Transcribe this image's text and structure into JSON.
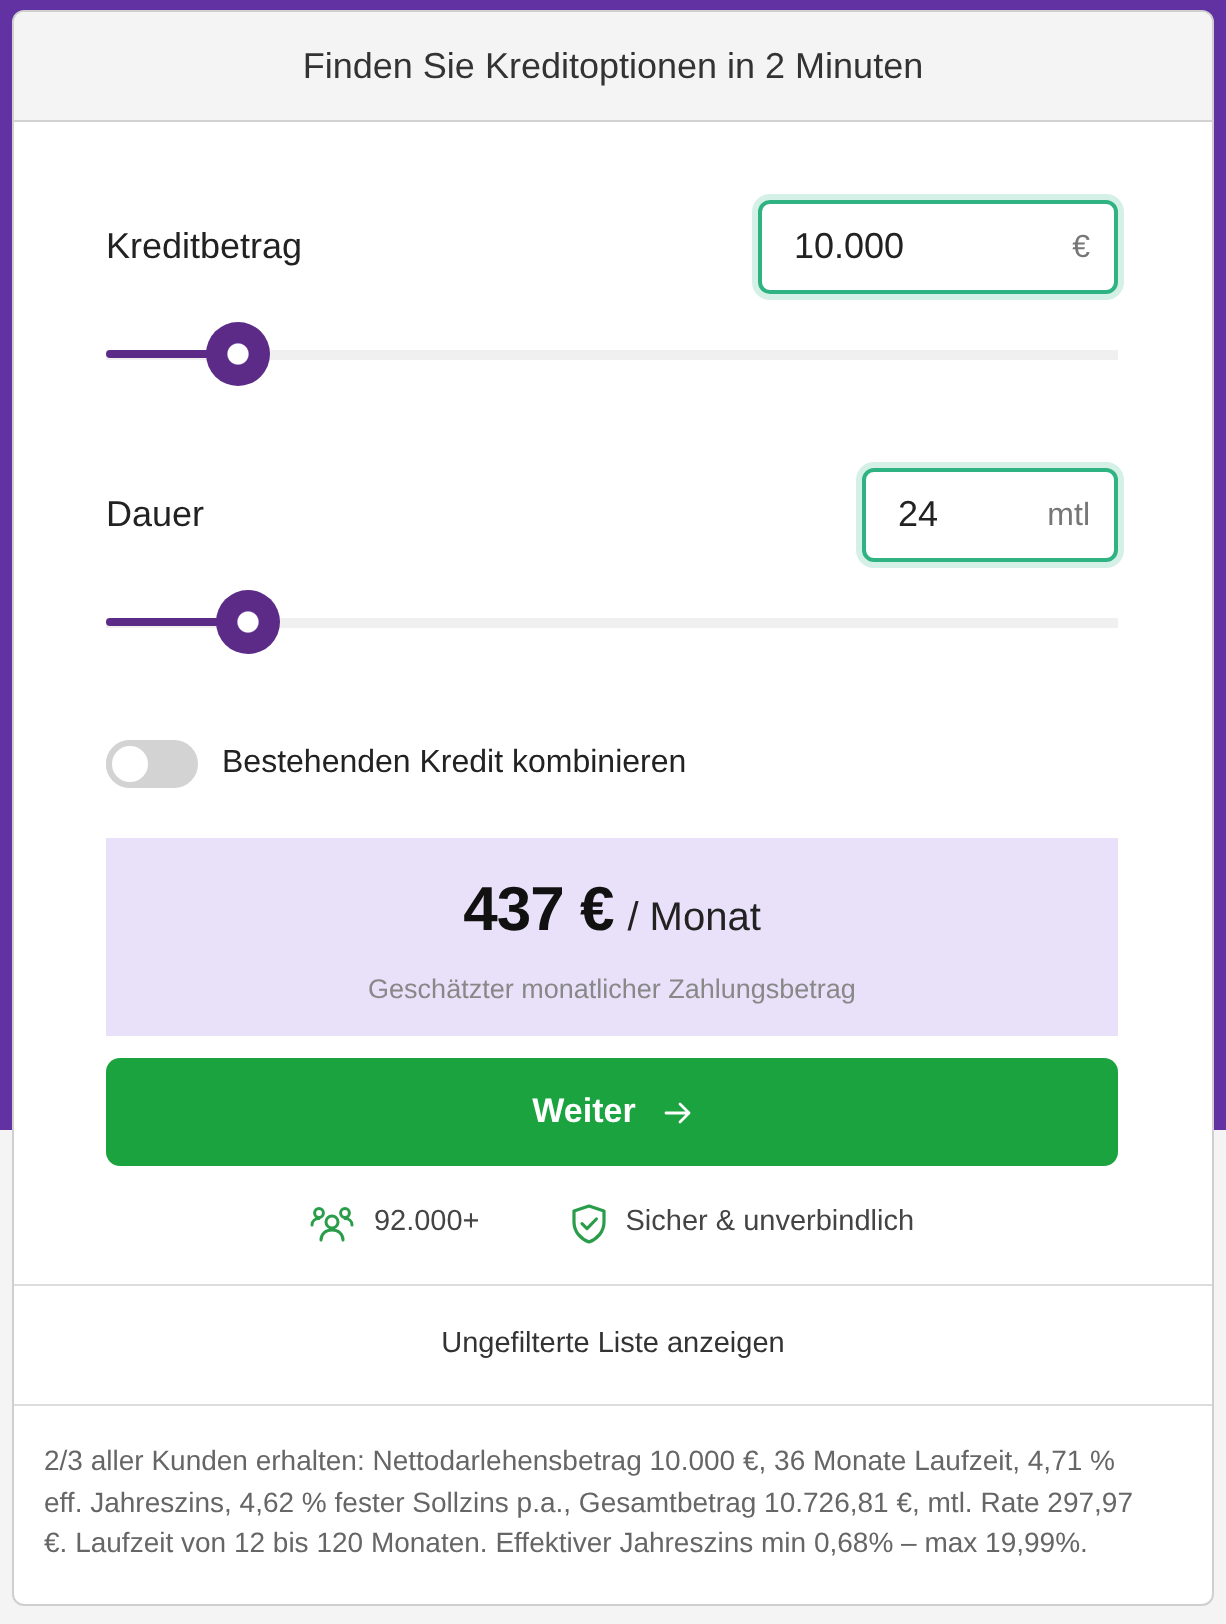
{
  "header": {
    "title": "Finden Sie Kreditoptionen in 2 Minuten"
  },
  "fields": [
    {
      "label": "Kreditbetrag",
      "value": "10.000",
      "unit": "€",
      "level": 0.13
    },
    {
      "label": "Dauer",
      "value": "24",
      "unit": "mtl",
      "level": 0.14
    }
  ],
  "toggle": {
    "label": "Bestehenden Kredit kombinieren",
    "on": false
  },
  "estimate": {
    "amount": "437 €",
    "period": "/ Monat",
    "caption": "Geschätzter monatlicher Zahlungsbetrag"
  },
  "primary_button": {
    "label": "Weiter"
  },
  "trust_badges": [
    {
      "kind": "customers",
      "text": "92.000+"
    },
    {
      "kind": "security",
      "text": "Sicher & unverbindlich"
    }
  ],
  "link": {
    "label": "Ungefilterte Liste anzeigen"
  },
  "disclaimer": "2/3 aller Kunden erhalten: Nettodarlehensbetrag 10.000 €, 36 Monate Laufzeit, 4,71 % eff. Jahreszins, 4,62 % fester Sollzins p.a., Gesamtbetrag 10.726,81 €, mtl. Rate 297,97 €. Laufzeit von 12 bis 120 Monaten. Effektiver Jahreszins min 0,68% – max 19,99%."
}
